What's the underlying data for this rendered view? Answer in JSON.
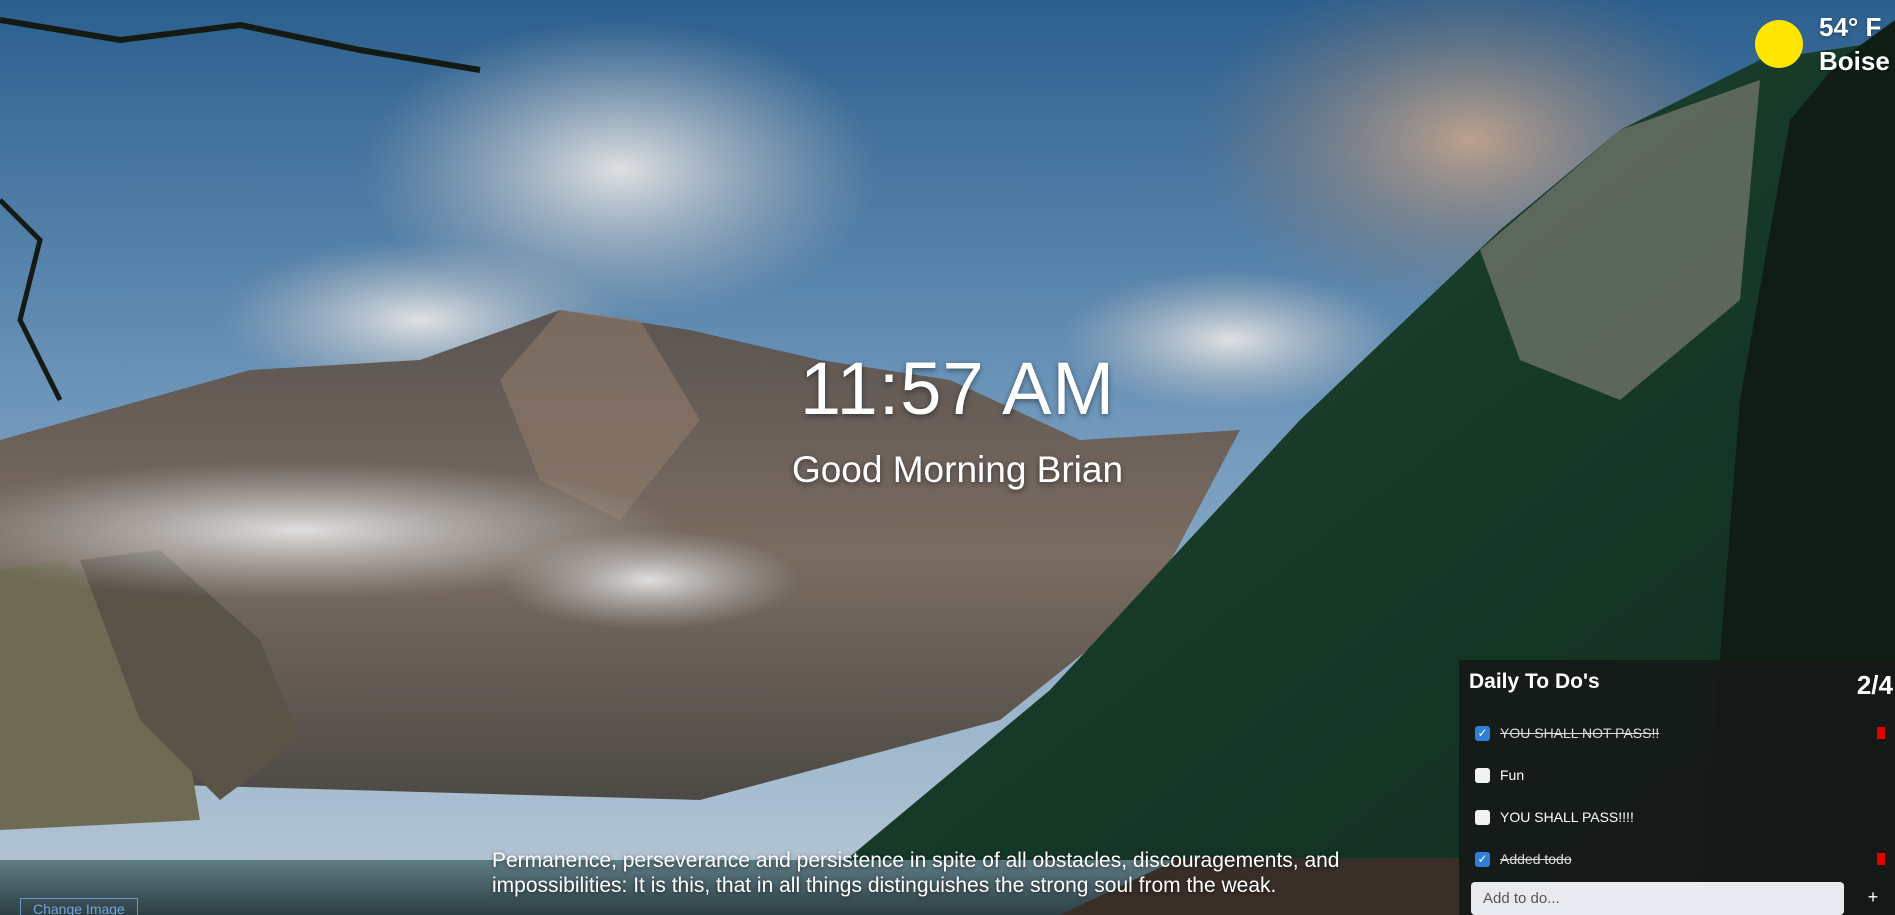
{
  "clock": {
    "time": "11:57 AM"
  },
  "greeting": {
    "text": "Good Morning Brian"
  },
  "weather": {
    "temperature": "54° F",
    "city": "Boise",
    "sun_color": "#ffe600"
  },
  "quote": {
    "text": "Permanence, perseverance and persistence in spite of all obstacles, discouragements, and impossibilities: It is this, that in all things distinguishes the strong soul from the weak."
  },
  "background": {
    "change_image_label": "Change Image"
  },
  "todo": {
    "title": "Daily To Do's",
    "count": "2/4",
    "items": [
      {
        "label": "YOU SHALL NOT PASS!!",
        "done": true
      },
      {
        "label": "Fun",
        "done": false
      },
      {
        "label": "YOU SHALL PASS!!!!",
        "done": false
      },
      {
        "label": "Added todo",
        "done": true
      }
    ],
    "add_placeholder": "Add to do...",
    "add_button_label": "+",
    "accent_color": "#2f7ed8",
    "delete_color": "#e00000"
  }
}
